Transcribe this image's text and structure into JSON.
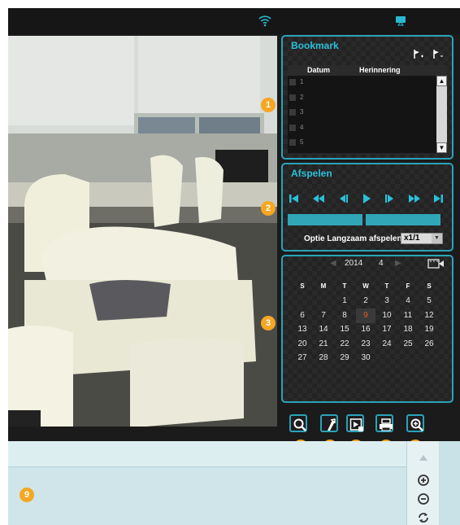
{
  "colors": {
    "accent": "#2aa3b9",
    "badge": "#f5a623",
    "selected_day": "#e85a1f",
    "panel_bg": "#232323"
  },
  "topbar": {
    "icons": [
      "wifi-icon",
      "cast-icon"
    ]
  },
  "bookmark": {
    "title": "Bookmark",
    "columns": [
      "Datum",
      "Herinnering"
    ],
    "rows": [
      "1",
      "2",
      "3",
      "4",
      "5"
    ],
    "icons": [
      "add-bookmark-flag-icon",
      "remove-bookmark-flag-icon"
    ]
  },
  "playback": {
    "title": "Afspelen",
    "controls": [
      "skip-to-start-icon",
      "fast-rewind-icon",
      "step-back-icon",
      "play-icon",
      "step-forward-icon",
      "fast-forward-icon",
      "skip-to-end-icon"
    ],
    "slow_label": "Optie Langzaam afspelen",
    "slow_value": "x1/1"
  },
  "calendar": {
    "year": "2014",
    "month": "4",
    "weekdays": [
      "S",
      "M",
      "T",
      "W",
      "T",
      "F",
      "S"
    ],
    "weeks": [
      [
        "",
        "",
        "1",
        "2",
        "3",
        "4",
        "5"
      ],
      [
        "6",
        "7",
        "8",
        "9",
        "10",
        "11",
        "12"
      ],
      [
        "13",
        "14",
        "15",
        "16",
        "17",
        "18",
        "19"
      ],
      [
        "20",
        "21",
        "22",
        "23",
        "24",
        "25",
        "26"
      ],
      [
        "27",
        "28",
        "29",
        "30",
        "",
        "",
        ""
      ]
    ],
    "selected_day": "9"
  },
  "tools": [
    "search-icon",
    "export-icon",
    "playback-window-icon",
    "print-icon",
    "zoom-in-icon"
  ],
  "badges": [
    "1",
    "2",
    "3",
    "4",
    "5",
    "6",
    "7",
    "8",
    "9"
  ],
  "timeline_zoom": [
    "zoom-in-circle-icon",
    "zoom-out-circle-icon",
    "refresh-icon"
  ]
}
